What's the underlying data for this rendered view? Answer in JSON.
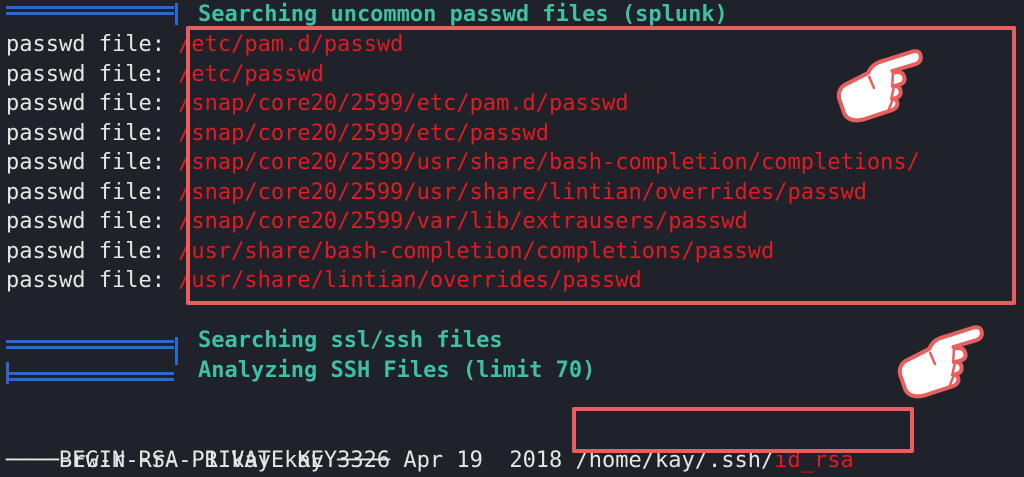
{
  "sections": {
    "uncommon_passwd": {
      "title": "Searching uncommon passwd files (splunk)",
      "label": "passwd file: ",
      "files": [
        "/etc/pam.d/passwd",
        "/etc/passwd",
        "/snap/core20/2599/etc/pam.d/passwd",
        "/snap/core20/2599/etc/passwd",
        "/snap/core20/2599/usr/share/bash-completion/completions/",
        "/snap/core20/2599/usr/share/lintian/overrides/passwd",
        "/snap/core20/2599/var/lib/extrausers/passwd",
        "/usr/share/bash-completion/completions/passwd",
        "/usr/share/lintian/overrides/passwd"
      ]
    },
    "ssl_ssh": {
      "title": "Searching ssl/ssh files",
      "subtitle": "Analyzing SSH Files (limit 70)"
    }
  },
  "ls_line": {
    "meta": "-rw-r--r-- 1 kay kay 3326 Apr 19  2018 ",
    "path_dir": "/home/kay/.ssh/",
    "path_file": "id_rsa"
  },
  "rsa_line": "────BEGIN RSA PRIVATE KEY────",
  "colors": {
    "background": "#1f2229",
    "header_text": "#3ebfa6",
    "marker_blue": "#2f68c9",
    "path_red": "#e01b24",
    "highlight_border": "#e85f5f"
  },
  "icons": [
    "pointing-hand-icon",
    "pointing-hand-icon"
  ]
}
